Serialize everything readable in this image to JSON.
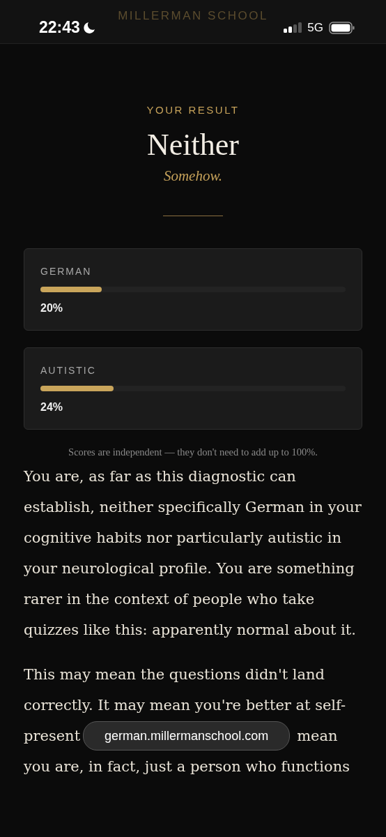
{
  "status_bar": {
    "time": "22:43",
    "network": "5G"
  },
  "site_header": {
    "title": "MILLERMAN SCHOOL"
  },
  "result": {
    "label": "YOUR RESULT",
    "title": "Neither",
    "subtitle": "Somehow."
  },
  "scores": [
    {
      "name": "GERMAN",
      "level": 0.2,
      "reading": "20%"
    },
    {
      "name": "AUTISTIC",
      "level": 0.24,
      "reading": "24%"
    }
  ],
  "note": "Scores are independent — they don't need to add up to 100%.",
  "paragraph_1": "You are, as far as this diagnostic can establish, neither specifically German in your cognitive habits nor particularly autistic in your neurological profile. You are something rarer in the context of people who take quizzes like this: apparently normal about it.",
  "paragraph_2_lines": [
    {
      "text": "This may mean the questions didn't land"
    },
    {
      "text": "correctly. It may mean you're better at self-"
    },
    {
      "text": "present",
      "after_url_bar": "mean"
    },
    {
      "text": "you are, in fact, just a person who functions"
    }
  ],
  "url_bar": {
    "address": "german.millermanschool.com"
  }
}
